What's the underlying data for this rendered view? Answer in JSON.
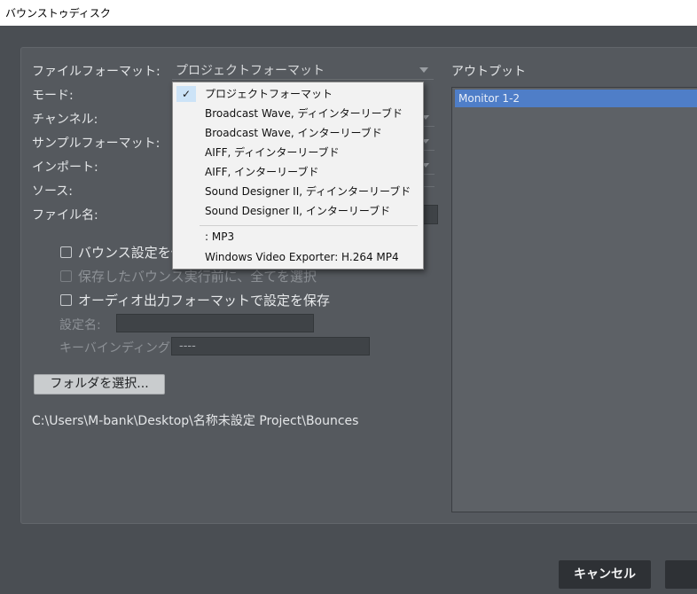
{
  "window": {
    "title": "バウンストゥディスク"
  },
  "form": {
    "file_format_label": "ファイルフォーマット:",
    "file_format_value": "プロジェクトフォーマット",
    "mode_label": "モード:",
    "channel_label": "チャンネル:",
    "sample_format_label": "サンプルフォーマット:",
    "import_label": "インポート:",
    "source_label": "ソース:",
    "filename_label": "ファイル名:"
  },
  "options": {
    "save_bounce_settings": "バウンス設定を保",
    "select_all_before_saved": "保存したバウンス実行前に、全てを選択",
    "save_audio_output_format": "オーディオ出力フォーマットで設定を保存",
    "setting_name_label": "設定名:",
    "key_binding_label": "キーバインディング:",
    "key_binding_value": "----"
  },
  "folder": {
    "select_button": "フォルダを選択...",
    "path": "C:\\Users\\M-bank\\Desktop\\名称未設定 Project\\Bounces"
  },
  "output": {
    "label": "アウトプット",
    "items": [
      "Monitor 1-2"
    ]
  },
  "buttons": {
    "cancel": "キャンセル"
  },
  "dropdown": {
    "check_icon": "✓",
    "items": [
      "プロジェクトフォーマット",
      "Broadcast Wave, ディインターリーブド",
      "Broadcast Wave, インターリーブド",
      "AIFF, ディインターリーブド",
      "AIFF, インターリーブド",
      "Sound Designer II, ディインターリーブド",
      "Sound Designer II, インターリーブド",
      ": MP3",
      "Windows Video Exporter: H.264 MP4"
    ],
    "selected_index": 0
  },
  "colors": {
    "background": "#4a4e53",
    "panel": "#55595e",
    "selection": "#4f7ec8",
    "check_highlight": "#cce3f7"
  }
}
